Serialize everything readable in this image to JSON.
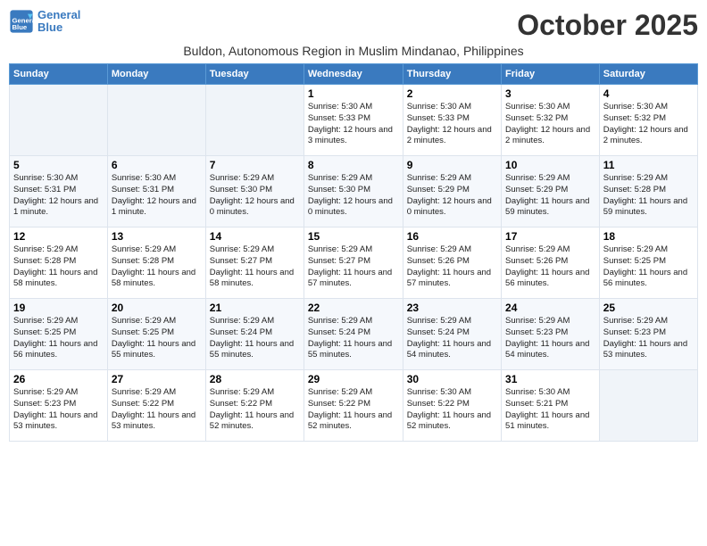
{
  "header": {
    "logo_line1": "General",
    "logo_line2": "Blue",
    "month_title": "October 2025",
    "location": "Buldon, Autonomous Region in Muslim Mindanao, Philippines"
  },
  "weekdays": [
    "Sunday",
    "Monday",
    "Tuesday",
    "Wednesday",
    "Thursday",
    "Friday",
    "Saturday"
  ],
  "weeks": [
    [
      {
        "day": "",
        "info": ""
      },
      {
        "day": "",
        "info": ""
      },
      {
        "day": "",
        "info": ""
      },
      {
        "day": "1",
        "info": "Sunrise: 5:30 AM\nSunset: 5:33 PM\nDaylight: 12 hours and 3 minutes."
      },
      {
        "day": "2",
        "info": "Sunrise: 5:30 AM\nSunset: 5:33 PM\nDaylight: 12 hours and 2 minutes."
      },
      {
        "day": "3",
        "info": "Sunrise: 5:30 AM\nSunset: 5:32 PM\nDaylight: 12 hours and 2 minutes."
      },
      {
        "day": "4",
        "info": "Sunrise: 5:30 AM\nSunset: 5:32 PM\nDaylight: 12 hours and 2 minutes."
      }
    ],
    [
      {
        "day": "5",
        "info": "Sunrise: 5:30 AM\nSunset: 5:31 PM\nDaylight: 12 hours and 1 minute."
      },
      {
        "day": "6",
        "info": "Sunrise: 5:30 AM\nSunset: 5:31 PM\nDaylight: 12 hours and 1 minute."
      },
      {
        "day": "7",
        "info": "Sunrise: 5:29 AM\nSunset: 5:30 PM\nDaylight: 12 hours and 0 minutes."
      },
      {
        "day": "8",
        "info": "Sunrise: 5:29 AM\nSunset: 5:30 PM\nDaylight: 12 hours and 0 minutes."
      },
      {
        "day": "9",
        "info": "Sunrise: 5:29 AM\nSunset: 5:29 PM\nDaylight: 12 hours and 0 minutes."
      },
      {
        "day": "10",
        "info": "Sunrise: 5:29 AM\nSunset: 5:29 PM\nDaylight: 11 hours and 59 minutes."
      },
      {
        "day": "11",
        "info": "Sunrise: 5:29 AM\nSunset: 5:28 PM\nDaylight: 11 hours and 59 minutes."
      }
    ],
    [
      {
        "day": "12",
        "info": "Sunrise: 5:29 AM\nSunset: 5:28 PM\nDaylight: 11 hours and 58 minutes."
      },
      {
        "day": "13",
        "info": "Sunrise: 5:29 AM\nSunset: 5:28 PM\nDaylight: 11 hours and 58 minutes."
      },
      {
        "day": "14",
        "info": "Sunrise: 5:29 AM\nSunset: 5:27 PM\nDaylight: 11 hours and 58 minutes."
      },
      {
        "day": "15",
        "info": "Sunrise: 5:29 AM\nSunset: 5:27 PM\nDaylight: 11 hours and 57 minutes."
      },
      {
        "day": "16",
        "info": "Sunrise: 5:29 AM\nSunset: 5:26 PM\nDaylight: 11 hours and 57 minutes."
      },
      {
        "day": "17",
        "info": "Sunrise: 5:29 AM\nSunset: 5:26 PM\nDaylight: 11 hours and 56 minutes."
      },
      {
        "day": "18",
        "info": "Sunrise: 5:29 AM\nSunset: 5:25 PM\nDaylight: 11 hours and 56 minutes."
      }
    ],
    [
      {
        "day": "19",
        "info": "Sunrise: 5:29 AM\nSunset: 5:25 PM\nDaylight: 11 hours and 56 minutes."
      },
      {
        "day": "20",
        "info": "Sunrise: 5:29 AM\nSunset: 5:25 PM\nDaylight: 11 hours and 55 minutes."
      },
      {
        "day": "21",
        "info": "Sunrise: 5:29 AM\nSunset: 5:24 PM\nDaylight: 11 hours and 55 minutes."
      },
      {
        "day": "22",
        "info": "Sunrise: 5:29 AM\nSunset: 5:24 PM\nDaylight: 11 hours and 55 minutes."
      },
      {
        "day": "23",
        "info": "Sunrise: 5:29 AM\nSunset: 5:24 PM\nDaylight: 11 hours and 54 minutes."
      },
      {
        "day": "24",
        "info": "Sunrise: 5:29 AM\nSunset: 5:23 PM\nDaylight: 11 hours and 54 minutes."
      },
      {
        "day": "25",
        "info": "Sunrise: 5:29 AM\nSunset: 5:23 PM\nDaylight: 11 hours and 53 minutes."
      }
    ],
    [
      {
        "day": "26",
        "info": "Sunrise: 5:29 AM\nSunset: 5:23 PM\nDaylight: 11 hours and 53 minutes."
      },
      {
        "day": "27",
        "info": "Sunrise: 5:29 AM\nSunset: 5:22 PM\nDaylight: 11 hours and 53 minutes."
      },
      {
        "day": "28",
        "info": "Sunrise: 5:29 AM\nSunset: 5:22 PM\nDaylight: 11 hours and 52 minutes."
      },
      {
        "day": "29",
        "info": "Sunrise: 5:29 AM\nSunset: 5:22 PM\nDaylight: 11 hours and 52 minutes."
      },
      {
        "day": "30",
        "info": "Sunrise: 5:30 AM\nSunset: 5:22 PM\nDaylight: 11 hours and 52 minutes."
      },
      {
        "day": "31",
        "info": "Sunrise: 5:30 AM\nSunset: 5:21 PM\nDaylight: 11 hours and 51 minutes."
      },
      {
        "day": "",
        "info": ""
      }
    ]
  ]
}
